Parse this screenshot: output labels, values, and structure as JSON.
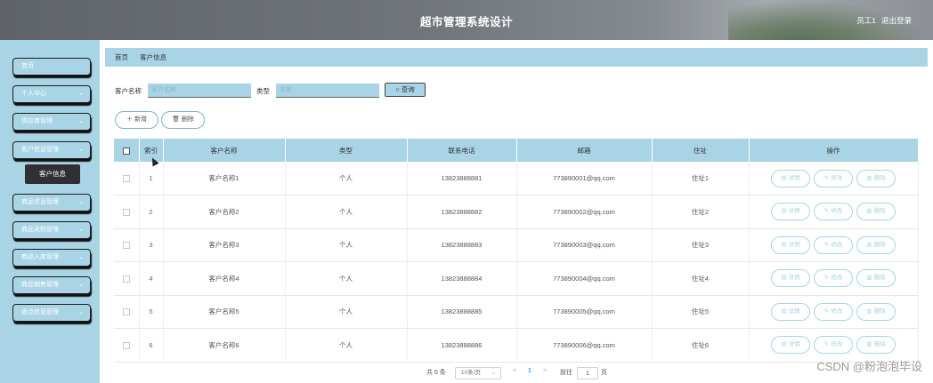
{
  "header": {
    "title": "超市管理系统设计",
    "user": "员工1",
    "logout": "退出登录"
  },
  "sidebar": {
    "items": [
      {
        "label": "首页",
        "chevron": ""
      },
      {
        "label": "个人中心",
        "chevron": "⌄"
      },
      {
        "label": "供应商管理",
        "chevron": "⌄"
      },
      {
        "label": "客户信息管理",
        "chevron": "⌄"
      },
      {
        "label": "商品信息管理",
        "chevron": "⌄"
      },
      {
        "label": "商品采购管理",
        "chevron": "⌄"
      },
      {
        "label": "商品入库管理",
        "chevron": "⌄"
      },
      {
        "label": "商品销售管理",
        "chevron": "⌄"
      },
      {
        "label": "盘点信息管理",
        "chevron": "⌄"
      }
    ],
    "active_sub": "客户信息"
  },
  "breadcrumb": {
    "home": "首页",
    "current": "客户信息"
  },
  "search": {
    "name_label": "客户名称",
    "name_placeholder": "客户名称",
    "type_label": "类型",
    "type_placeholder": "类型",
    "query_icon": "search-icon",
    "query_label": "○ 查询"
  },
  "actions": {
    "add_label": "＋ 新增",
    "delete_label": "🗑 删除"
  },
  "table": {
    "columns": [
      "索引",
      "客户名称",
      "类型",
      "联系电话",
      "邮箱",
      "住址",
      "操作"
    ],
    "rows": [
      {
        "index": "1",
        "name": "客户名称1",
        "type": "个人",
        "phone": "13823888881",
        "email": "773890001@qq.com",
        "address": "住址1"
      },
      {
        "index": "2",
        "name": "客户名称2",
        "type": "个人",
        "phone": "13823888882",
        "email": "773890002@qq.com",
        "address": "住址2"
      },
      {
        "index": "3",
        "name": "客户名称3",
        "type": "个人",
        "phone": "13823888883",
        "email": "773890003@qq.com",
        "address": "住址3"
      },
      {
        "index": "4",
        "name": "客户名称4",
        "type": "个人",
        "phone": "13823888884",
        "email": "773890004@qq.com",
        "address": "住址4"
      },
      {
        "index": "5",
        "name": "客户名称5",
        "type": "个人",
        "phone": "13823888885",
        "email": "773890005@qq.com",
        "address": "住址5"
      },
      {
        "index": "6",
        "name": "客户名称6",
        "type": "个人",
        "phone": "13823888886",
        "email": "773890006@qq.com",
        "address": "住址6"
      }
    ],
    "ops": {
      "detail": "详情",
      "edit": "修改",
      "delete": "删除"
    }
  },
  "pagination": {
    "total": "共 6 条",
    "page_size": "10条/页",
    "prev": "<",
    "page": "1",
    "next": ">",
    "goto_label": "前往",
    "goto_value": "1",
    "page_unit": "页"
  },
  "watermark": "CSDN @粉泡泡毕设",
  "colors": {
    "accent": "#a9d4e5",
    "header": "#6f747a",
    "dark": "#2f3032"
  }
}
